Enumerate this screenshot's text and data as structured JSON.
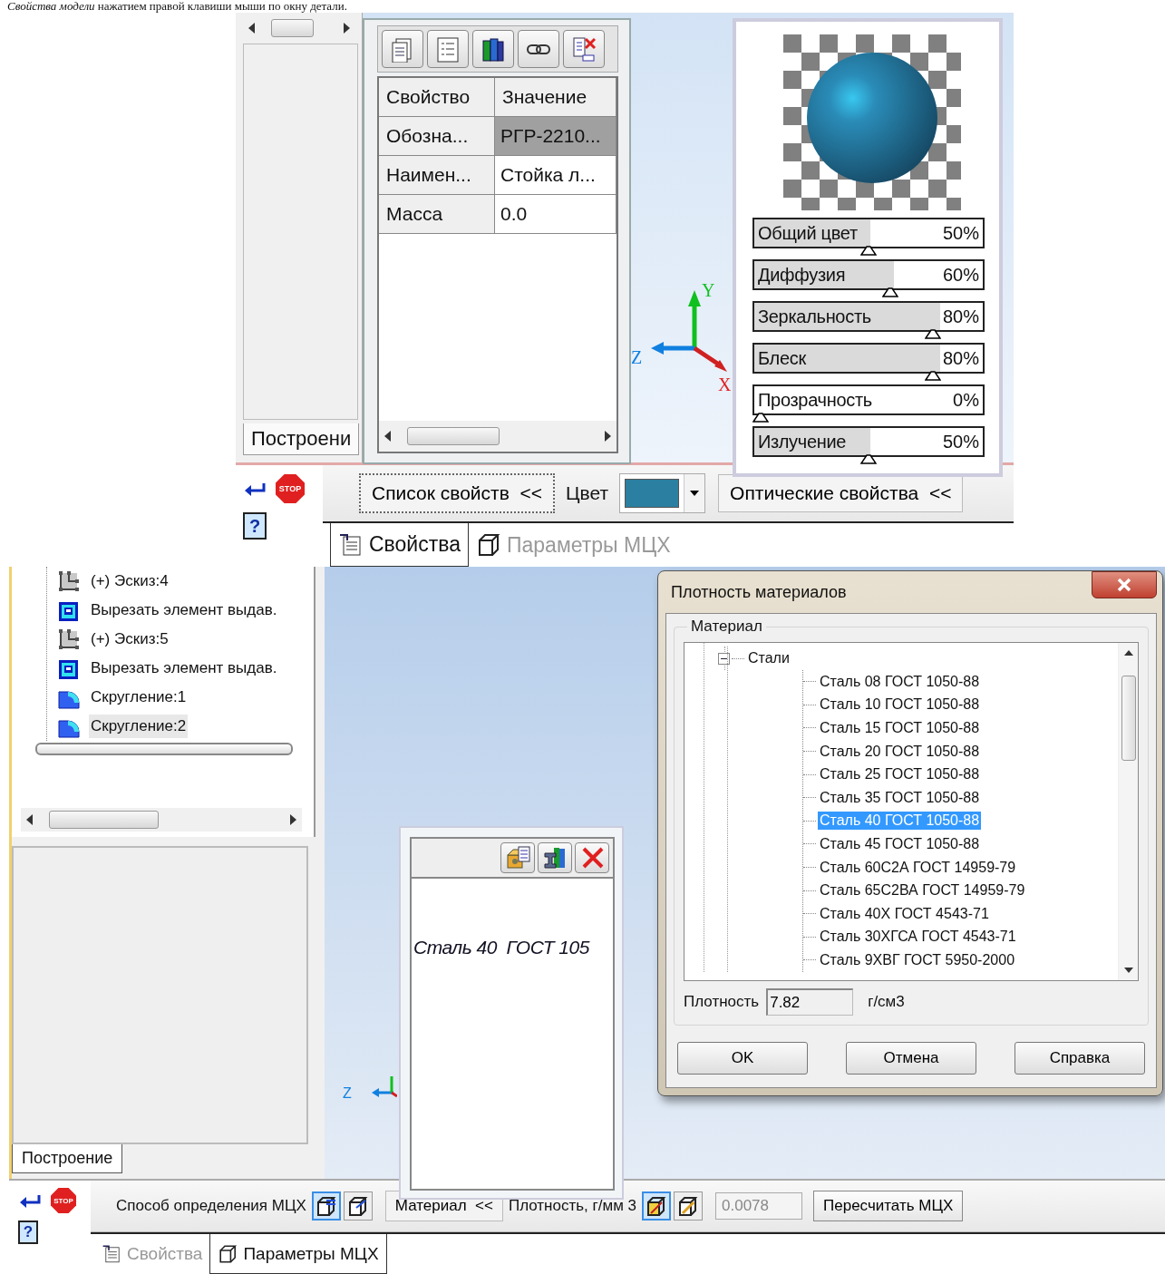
{
  "caption": "*Свойства модели* нажатием правой клавиши мыши по окну детали.",
  "screenshot_1": {
    "tree_panel": {
      "tab": "Построени"
    },
    "properties_panel": {
      "columns": [
        "Свойство",
        "Значение"
      ],
      "rows": [
        {
          "property": "Обозна...",
          "value": "РГР-2210...",
          "selected": true
        },
        {
          "property": "Наимен...",
          "value": "Стойка л...",
          "selected": false
        },
        {
          "property": "Масса",
          "value": "0.0",
          "selected": false
        }
      ]
    },
    "axes": {
      "y": "Y",
      "x": "X",
      "z": "Z"
    },
    "optical_panel": {
      "sliders": [
        {
          "label": "Общий цвет",
          "reading": "50%",
          "level": 0.5
        },
        {
          "label": "Диффузия",
          "reading": "60%",
          "level": 0.6
        },
        {
          "label": "Зеркальность",
          "reading": "80%",
          "level": 0.8
        },
        {
          "label": "Блеск",
          "reading": "80%",
          "level": 0.8
        },
        {
          "label": "Прозрачность",
          "reading": "0%",
          "level": 0
        },
        {
          "label": "Излучение",
          "reading": "50%",
          "level": 0.5
        }
      ]
    },
    "toolbar": {
      "stop_label": "STOP",
      "help_label": "?",
      "list_button": "Список свойств  <<",
      "color_label": "Цвет",
      "optical_button": "Оптические свойства  <<"
    },
    "tabs": [
      {
        "label": "Свойства",
        "selected": true
      },
      {
        "label": "Параметры МЦХ",
        "selected": false
      }
    ]
  },
  "screenshot_2": {
    "tree": [
      {
        "label": "(+) Эскиз:4",
        "kind": "sketch",
        "selected": false
      },
      {
        "label": "Вырезать элемент выдав.",
        "kind": "cut",
        "selected": false
      },
      {
        "label": "(+) Эскиз:5",
        "kind": "sketch",
        "selected": false
      },
      {
        "label": "Вырезать элемент выдав.",
        "kind": "cut",
        "selected": false
      },
      {
        "label": "Скругление:1",
        "kind": "fillet",
        "selected": false
      },
      {
        "label": "Скругление:2",
        "kind": "fillet",
        "selected": true
      }
    ],
    "tree_tab": "Построение",
    "axis_label": "Z",
    "material_panel": {
      "text": "Сталь 40  ГОСТ 105"
    },
    "dialog": {
      "title": "Плотность материалов",
      "group": "Материал",
      "tree": {
        "label": "Стали",
        "expanded": true,
        "children": [
          {
            "label": "Сталь 08  ГОСТ 1050-88",
            "selected": false
          },
          {
            "label": "Сталь 10  ГОСТ 1050-88",
            "selected": false
          },
          {
            "label": "Сталь 15  ГОСТ 1050-88",
            "selected": false
          },
          {
            "label": "Сталь 20  ГОСТ 1050-88",
            "selected": false
          },
          {
            "label": "Сталь 25  ГОСТ 1050-88",
            "selected": false
          },
          {
            "label": "Сталь 35  ГОСТ 1050-88",
            "selected": false
          },
          {
            "label": "Сталь 40  ГОСТ 1050-88",
            "selected": true
          },
          {
            "label": "Сталь 45  ГОСТ 1050-88",
            "selected": false
          },
          {
            "label": "Сталь 60С2А  ГОСТ 14959-79",
            "selected": false
          },
          {
            "label": "Сталь 65С2ВА  ГОСТ 14959-79",
            "selected": false
          },
          {
            "label": "Сталь 40Х  ГОСТ 4543-71",
            "selected": false
          },
          {
            "label": "Сталь 30ХГСА  ГОСТ 4543-71",
            "selected": false
          },
          {
            "label": "Сталь 9ХВГ  ГОСТ 5950-2000",
            "selected": false
          }
        ]
      },
      "density_label": "Плотность",
      "density_value": "7.82",
      "density_unit": "г/см3",
      "buttons": [
        "OK",
        "Отмена",
        "Справка"
      ]
    },
    "toolbar": {
      "stop_label": "STOP",
      "help_label": "?",
      "method_label": "Способ определения МЦХ",
      "method_buttons": [
        {
          "selected": true
        },
        {
          "selected": false
        }
      ],
      "material_button": "Материал  <<",
      "density_label": "Плотность, г/мм 3",
      "density_buttons": [
        {
          "selected": true
        },
        {
          "selected": false
        }
      ],
      "density_value": "0.0078",
      "recalc_button": "Пересчитать МЦХ"
    },
    "tabs": [
      {
        "label": "Свойства",
        "selected": false
      },
      {
        "label": "Параметры МЦХ",
        "selected": true
      }
    ]
  }
}
